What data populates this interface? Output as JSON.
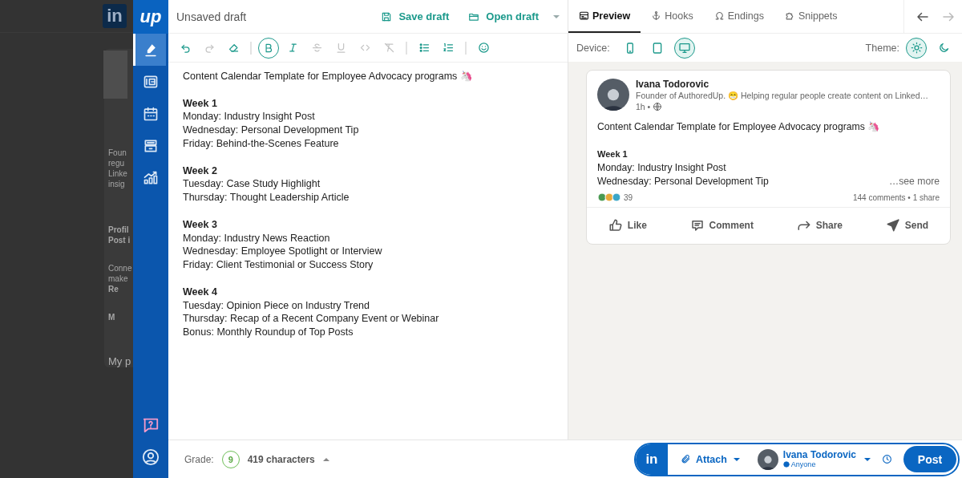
{
  "background_page": {
    "logo": "in",
    "headline_lines": [
      "Foun",
      "regu",
      "Linke",
      "insig"
    ],
    "stats": [
      "Profil",
      "Post i"
    ],
    "promo_lines": [
      "Conne",
      "make"
    ],
    "promo_link": "Re",
    "saved": "M",
    "section_title": "My p"
  },
  "sidebar": {
    "logo": "up",
    "items": [
      {
        "kind": "compose",
        "selected": true
      },
      {
        "kind": "templates",
        "selected": false
      },
      {
        "kind": "calendar",
        "selected": false
      },
      {
        "kind": "library",
        "selected": false
      },
      {
        "kind": "analytics",
        "selected": false
      }
    ],
    "bottom_items": [
      {
        "kind": "help",
        "selected": false
      },
      {
        "kind": "profile",
        "selected": false
      }
    ]
  },
  "editor": {
    "title": "Unsaved draft",
    "actions": [
      {
        "kind": "save",
        "label": "Save draft",
        "dropdown": false
      },
      {
        "kind": "open",
        "label": "Open draft",
        "dropdown": true
      }
    ],
    "tools": [
      {
        "kind": "undo",
        "active": false,
        "disabled": false
      },
      {
        "kind": "redo",
        "active": false,
        "disabled": true
      },
      {
        "kind": "eraser",
        "active": false,
        "disabled": false
      },
      {
        "kind": "separator"
      },
      {
        "kind": "bold",
        "active": true,
        "disabled": false
      },
      {
        "kind": "italic",
        "active": false,
        "disabled": false
      },
      {
        "kind": "strike",
        "active": false,
        "disabled": true
      },
      {
        "kind": "underline",
        "active": false,
        "disabled": true
      },
      {
        "kind": "code",
        "active": false,
        "disabled": true
      },
      {
        "kind": "clear",
        "active": false,
        "disabled": true
      },
      {
        "kind": "separator"
      },
      {
        "kind": "bullets",
        "active": false,
        "disabled": false
      },
      {
        "kind": "numbers",
        "active": false,
        "disabled": false
      },
      {
        "kind": "separator"
      },
      {
        "kind": "emoji",
        "active": false,
        "disabled": false
      }
    ],
    "intro": "Content Calendar Template for Employee Advocacy programs 🦄",
    "weeks": [
      {
        "heading": "Week 1",
        "items": [
          "Monday: Industry Insight Post",
          "Wednesday: Personal Development Tip",
          "Friday: Behind-the-Scenes Feature"
        ]
      },
      {
        "heading": "Week 2",
        "items": [
          "Tuesday: Case Study Highlight",
          "Thursday: Thought Leadership Article"
        ]
      },
      {
        "heading": "Week 3",
        "items": [
          "Monday: Industry News Reaction",
          "Wednesday: Employee Spotlight or Interview",
          "Friday: Client Testimonial or Success Story"
        ]
      },
      {
        "heading": "Week 4",
        "items": [
          "Tuesday: Opinion Piece on Industry Trend",
          "Thursday: Recap of a Recent Company Event or Webinar",
          "Bonus: Monthly Roundup of Top Posts"
        ]
      }
    ]
  },
  "preview": {
    "tabs": [
      {
        "kind": "preview",
        "label": "Preview",
        "selected": true
      },
      {
        "kind": "hooks",
        "label": "Hooks",
        "selected": false
      },
      {
        "kind": "endings",
        "label": "Endings",
        "selected": false
      },
      {
        "kind": "snippets",
        "label": "Snippets",
        "selected": false
      }
    ],
    "nav": [
      {
        "kind": "back",
        "disabled": false
      },
      {
        "kind": "forward",
        "disabled": true
      }
    ],
    "device_label": "Device:",
    "devices": [
      {
        "kind": "phone",
        "selected": false
      },
      {
        "kind": "tablet",
        "selected": false
      },
      {
        "kind": "desktop",
        "selected": true
      }
    ],
    "theme_label": "Theme:",
    "themes": [
      {
        "kind": "light",
        "selected": true
      },
      {
        "kind": "dark",
        "selected": false
      }
    ],
    "post": {
      "author": "Ivana Todorovic",
      "headline": "Founder of AuthoredUp. 😁 Helping regular people create content on Linked…",
      "time": "1h •",
      "intro": "Content Calendar Template for Employee Advocacy programs 🦄",
      "heading": "Week 1",
      "lines": [
        "Monday: Industry Insight Post",
        "Wednesday: Personal Development Tip"
      ],
      "see_more": "…see more",
      "reactions": "39",
      "stats": "144 comments • 1 share",
      "actions": [
        {
          "kind": "like",
          "label": "Like"
        },
        {
          "kind": "comment",
          "label": "Comment"
        },
        {
          "kind": "share",
          "label": "Share"
        },
        {
          "kind": "send",
          "label": "Send"
        }
      ]
    }
  },
  "footer": {
    "grade_label": "Grade:",
    "grade": "9",
    "characters": "419 characters",
    "network": "in",
    "attach": "Attach",
    "account_name": "Ivana Todorovic",
    "visibility": "Anyone",
    "post_button": "Post"
  }
}
